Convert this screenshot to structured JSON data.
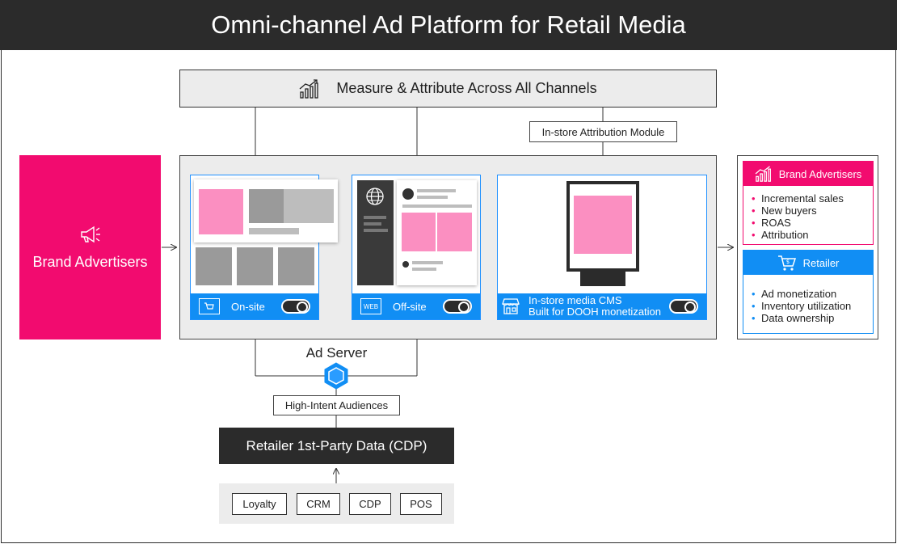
{
  "title": "Omni-channel Ad Platform for Retail Media",
  "measure": {
    "label": "Measure & Attribute Across All Channels",
    "icon": "growth-chart-icon"
  },
  "instore_attribution": "In-store Attribution Module",
  "brand_advertisers_left": {
    "label": "Brand Advertisers",
    "icon": "megaphone-icon"
  },
  "channels": [
    {
      "label": "On-site",
      "icon": "shopping-cart-window-icon"
    },
    {
      "label": "Off-site",
      "icon": "web-window-icon"
    },
    {
      "label": "In-store media CMS",
      "sublabel": "Built for DOOH monetization",
      "icon": "storefront-icon"
    }
  ],
  "ad_server": "Ad Server",
  "high_intent": "High-Intent Audiences",
  "cdp": "Retailer 1st-Party Data (CDP)",
  "sources": [
    "Loyalty",
    "CRM",
    "CDP",
    "POS"
  ],
  "web_badge": "WEB",
  "benefits": {
    "brand": {
      "title": "Brand Advertisers",
      "items": [
        "Incremental sales",
        "New buyers",
        "ROAS",
        "Attribution"
      ]
    },
    "retailer": {
      "title": "Retailer",
      "items": [
        "Ad monetization",
        "Inventory utilization",
        "Data ownership"
      ]
    }
  },
  "colors": {
    "pink": "#f20b6f",
    "blue": "#118ef4",
    "dark": "#2b2b2b",
    "light_gray": "#ececec"
  }
}
